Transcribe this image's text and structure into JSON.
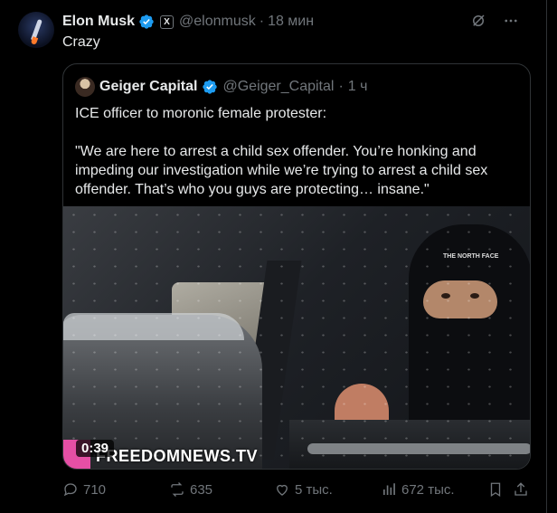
{
  "author": {
    "name": "Elon Musk",
    "handle": "@elonmusk",
    "separator": "·",
    "time": "18 мин",
    "verified_color": "#1d9bf0",
    "affiliate_badge": "X"
  },
  "tweet": {
    "text": "Crazy"
  },
  "quote": {
    "name": "Geiger Capital",
    "handle": "@Geiger_Capital",
    "separator": "·",
    "time": "1 ч",
    "paragraph1": "ICE officer to moronic female protester:",
    "paragraph2": "\"We are here to arrest a child sex offender. You’re honking and impeding our investigation while we’re trying to arrest a child sex offender. That’s who you guys are protecting… insane.\"",
    "media": {
      "duration": "0:39",
      "watermark": "FREEDOMNEWS.TV",
      "hat_logo": "THE NORTH FACE"
    }
  },
  "actions": {
    "replies": "710",
    "reposts": "635",
    "likes": "5 тыс.",
    "views": "672 тыс."
  },
  "icons": {
    "grok": "grok-icon",
    "more": "more-icon",
    "reply": "reply-icon",
    "repost": "repost-icon",
    "like": "heart-icon",
    "views": "views-icon",
    "bookmark": "bookmark-icon",
    "share": "share-icon"
  }
}
